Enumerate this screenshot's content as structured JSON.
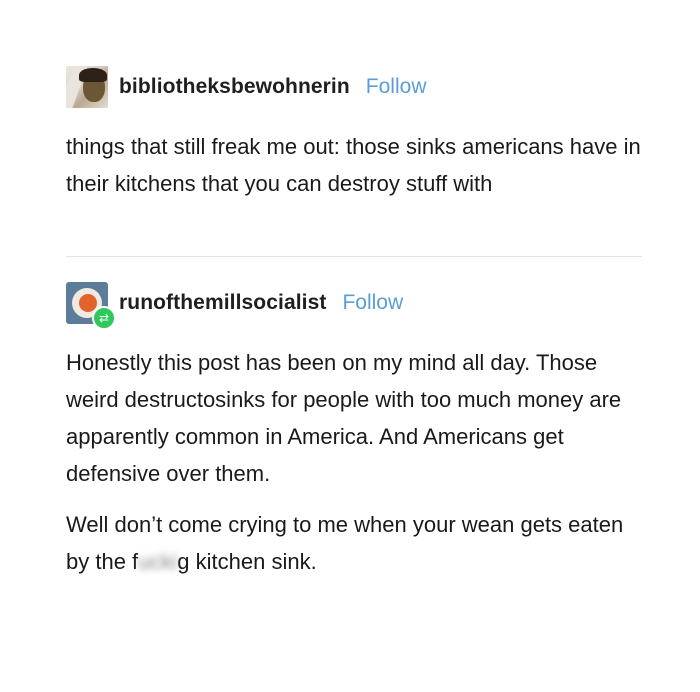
{
  "posts": [
    {
      "username": "bibliotheksbewohnerin",
      "follow_label": "Follow",
      "paragraphs": [
        "things that still freak me out: those sinks americans have in their kitchens that you can destroy stuff with"
      ]
    },
    {
      "username": "runofthemillsocialist",
      "follow_label": "Follow",
      "reblog_icon": "reblog-icon",
      "paragraphs": [
        "Honestly this post has been on my mind all day. Those weird destructosinks for people with too much money are apparently common in America. And Americans get defensive over them."
      ],
      "last_paragraph": {
        "before": "Well don’t come crying to me when your wean gets eaten by the f",
        "censored": "ucki",
        "after": "g kitchen sink."
      }
    }
  ],
  "colors": {
    "follow": "#5a9ed8",
    "reblog_badge": "#2fc85a",
    "text": "#1a1a1a"
  }
}
